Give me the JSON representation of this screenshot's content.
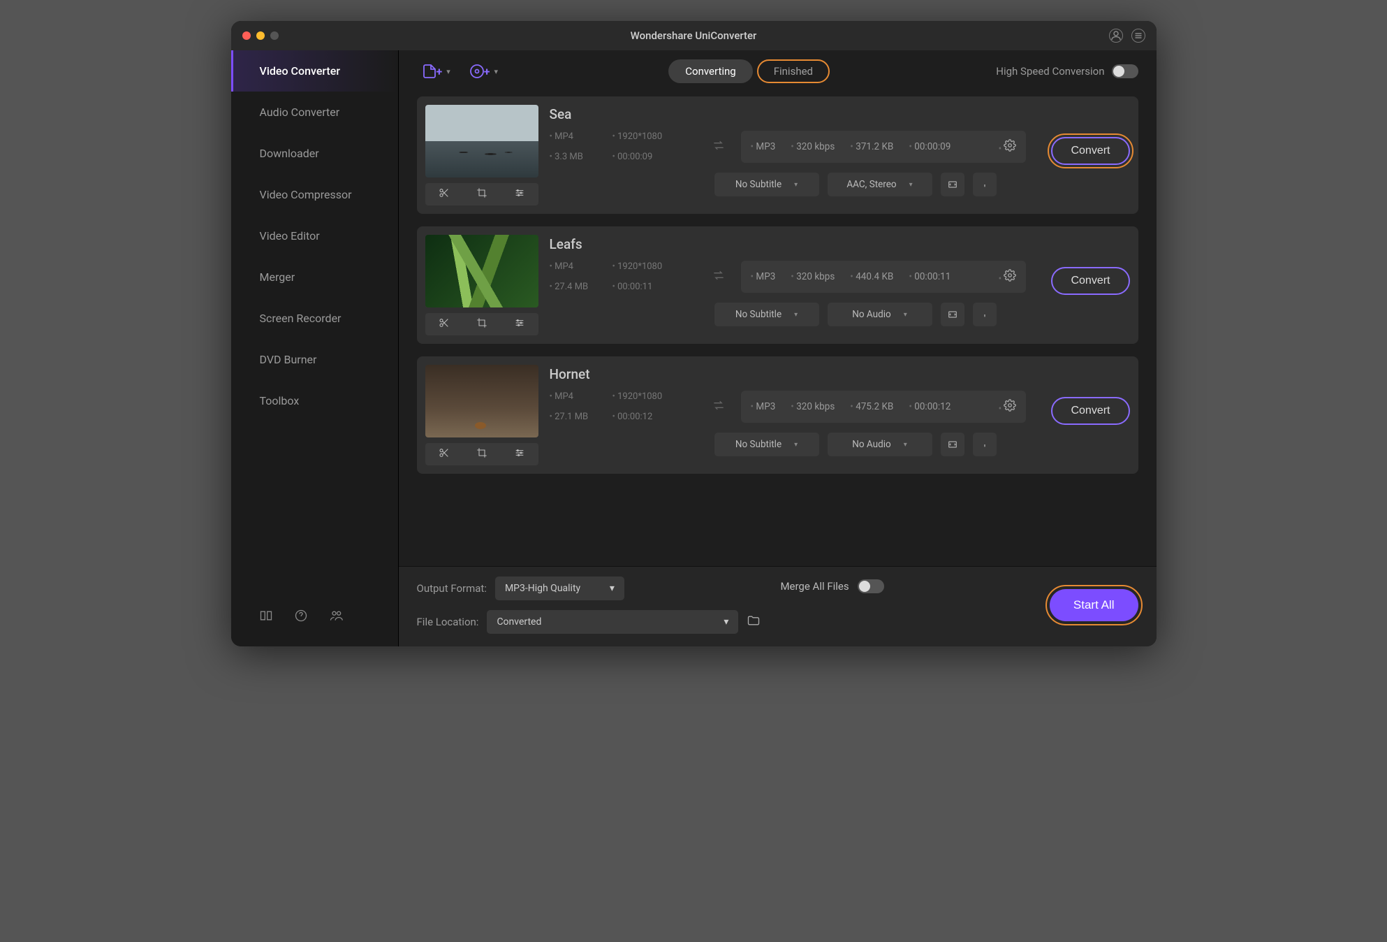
{
  "app": {
    "title": "Wondershare UniConverter"
  },
  "sidebar": {
    "items": [
      {
        "label": "Video Converter",
        "active": true
      },
      {
        "label": "Audio Converter"
      },
      {
        "label": "Downloader"
      },
      {
        "label": "Video Compressor"
      },
      {
        "label": "Video Editor"
      },
      {
        "label": "Merger"
      },
      {
        "label": "Screen Recorder"
      },
      {
        "label": "DVD Burner"
      },
      {
        "label": "Toolbox"
      }
    ]
  },
  "toolbar": {
    "tab_converting": "Converting",
    "tab_finished": "Finished",
    "active_tab": "Converting",
    "high_speed_label": "High Speed Conversion",
    "high_speed_on": false
  },
  "videos": [
    {
      "name": "Sea",
      "thumb_class": "sea",
      "src": {
        "format": "MP4",
        "res": "1920*1080",
        "size": "3.3 MB",
        "dur": "00:00:09"
      },
      "dst": {
        "format": "MP3",
        "bitrate": "320 kbps",
        "size": "371.2 KB",
        "dur": "00:00:09"
      },
      "subtitle": "No Subtitle",
      "audio": "AAC, Stereo",
      "convert_label": "Convert",
      "highlight": true
    },
    {
      "name": "Leafs",
      "thumb_class": "leafs",
      "src": {
        "format": "MP4",
        "res": "1920*1080",
        "size": "27.4 MB",
        "dur": "00:00:11"
      },
      "dst": {
        "format": "MP3",
        "bitrate": "320 kbps",
        "size": "440.4 KB",
        "dur": "00:00:11"
      },
      "subtitle": "No Subtitle",
      "audio": "No Audio",
      "convert_label": "Convert",
      "highlight": false
    },
    {
      "name": "Hornet",
      "thumb_class": "hornet",
      "src": {
        "format": "MP4",
        "res": "1920*1080",
        "size": "27.1 MB",
        "dur": "00:00:12"
      },
      "dst": {
        "format": "MP3",
        "bitrate": "320 kbps",
        "size": "475.2 KB",
        "dur": "00:00:12"
      },
      "subtitle": "No Subtitle",
      "audio": "No Audio",
      "convert_label": "Convert",
      "highlight": false
    }
  ],
  "footer": {
    "output_format_label": "Output Format:",
    "output_format_value": "MP3-High Quality",
    "file_location_label": "File Location:",
    "file_location_value": "Converted",
    "merge_label": "Merge All Files",
    "merge_on": false,
    "start_all_label": "Start All"
  }
}
